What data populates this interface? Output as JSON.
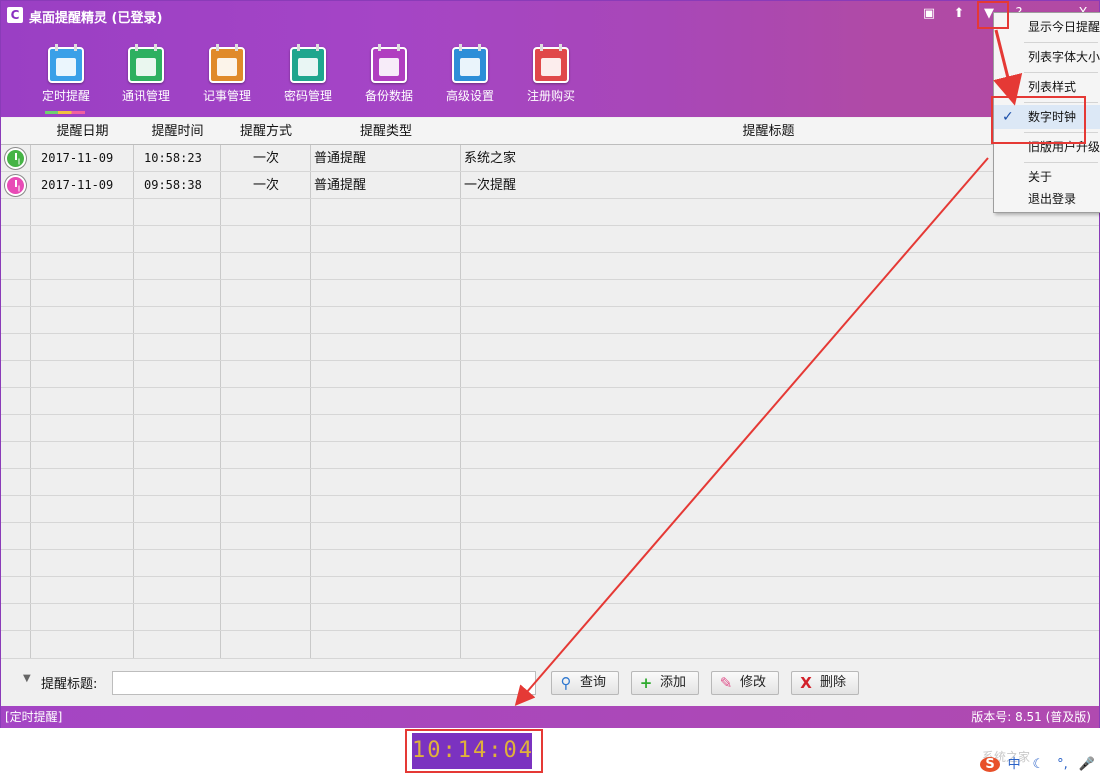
{
  "app": {
    "title": "桌面提醒精灵 (已登录)",
    "logo_char": "C"
  },
  "titlebar": {
    "skin_icon": "▣",
    "pin_icon": "⬆",
    "menu_icon": "▼",
    "help_icon": "?",
    "close_icon": "X"
  },
  "toolbar": {
    "items": [
      {
        "label": "定时提醒",
        "color": "#3aa0e8"
      },
      {
        "label": "通讯管理",
        "color": "#2eb060"
      },
      {
        "label": "记事管理",
        "color": "#e08a2a"
      },
      {
        "label": "密码管理",
        "color": "#1fa68e"
      },
      {
        "label": "备份数据",
        "color": "#b03ec0"
      },
      {
        "label": "高级设置",
        "color": "#2d8ed8"
      },
      {
        "label": "注册购买",
        "color": "#e0484a"
      }
    ]
  },
  "table": {
    "headers": [
      "提醒日期",
      "提醒时间",
      "提醒方式",
      "提醒类型",
      "提醒标题"
    ],
    "rows": [
      {
        "date": "2017-11-09",
        "time": "10:58:23",
        "mode": "一次",
        "type": "普通提醒",
        "title": "系统之家",
        "icon_color": "#46b446"
      },
      {
        "date": "2017-11-09",
        "time": "09:58:38",
        "mode": "一次",
        "type": "普通提醒",
        "title": "一次提醒",
        "icon_color": "#e84bb6"
      }
    ]
  },
  "search": {
    "label": "提醒标题:",
    "value": "",
    "query_btn": "查询",
    "add_btn": "添加",
    "edit_btn": "修改",
    "delete_btn": "删除"
  },
  "status": {
    "left": "[定时提醒]",
    "right": "版本号: 8.51 (普及版)"
  },
  "menu": {
    "items": [
      "显示今日提醒",
      "列表字体大小",
      "列表样式",
      "数字时钟",
      "旧版用户升级",
      "关于",
      "退出登录"
    ],
    "check": "✓"
  },
  "clock": {
    "time": "10:14:04"
  },
  "watermark": "系统之家",
  "ime": {
    "logo": "S",
    "lang": "中",
    "moon": "☾",
    "comma": "°,",
    "mic": "🎤"
  }
}
